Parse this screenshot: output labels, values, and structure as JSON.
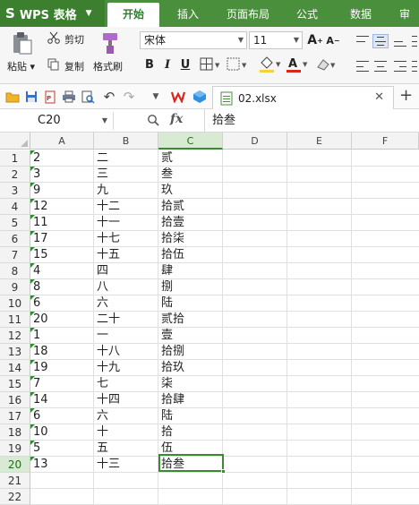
{
  "app": {
    "name": "WPS 表格",
    "logo": "S"
  },
  "tabs": [
    {
      "label": "开始",
      "active": true
    },
    {
      "label": "插入",
      "active": false
    },
    {
      "label": "页面布局",
      "active": false
    },
    {
      "label": "公式",
      "active": false
    },
    {
      "label": "数据",
      "active": false
    },
    {
      "label": "审",
      "active": false
    }
  ],
  "ribbon": {
    "paste": "粘贴",
    "cut": "剪切",
    "copy": "复制",
    "format_painter": "格式刷",
    "font_name": "宋体",
    "font_size": "11",
    "bold": "B",
    "italic": "I",
    "underline": "U",
    "grow_font": "A",
    "shrink_font": "A",
    "font_color_glyph": "A"
  },
  "colors": {
    "brand": "#4a8f3c",
    "accent": "#3b8a33",
    "font_color": "#d9261c",
    "fill_color": "#f4d03f"
  },
  "document": {
    "filename": "02.xlsx"
  },
  "formula_bar": {
    "cell_ref": "C20",
    "fx": "fx",
    "content": "拾叁"
  },
  "columns": [
    "A",
    "B",
    "C",
    "D",
    "E",
    "F"
  ],
  "rows": [
    {
      "n": "1",
      "a": "2",
      "b": "二",
      "c": "贰"
    },
    {
      "n": "2",
      "a": "3",
      "b": "三",
      "c": "叁"
    },
    {
      "n": "3",
      "a": "9",
      "b": "九",
      "c": "玖"
    },
    {
      "n": "4",
      "a": "12",
      "b": "十二",
      "c": "拾贰"
    },
    {
      "n": "5",
      "a": "11",
      "b": "十一",
      "c": "拾壹"
    },
    {
      "n": "6",
      "a": "17",
      "b": "十七",
      "c": "拾柒"
    },
    {
      "n": "7",
      "a": "15",
      "b": "十五",
      "c": "拾伍"
    },
    {
      "n": "8",
      "a": "4",
      "b": "四",
      "c": "肆"
    },
    {
      "n": "9",
      "a": "8",
      "b": "八",
      "c": "捌"
    },
    {
      "n": "10",
      "a": "6",
      "b": "六",
      "c": "陆"
    },
    {
      "n": "11",
      "a": "20",
      "b": "二十",
      "c": "贰拾"
    },
    {
      "n": "12",
      "a": "1",
      "b": "一",
      "c": "壹"
    },
    {
      "n": "13",
      "a": "18",
      "b": "十八",
      "c": "拾捌"
    },
    {
      "n": "14",
      "a": "19",
      "b": "十九",
      "c": "拾玖"
    },
    {
      "n": "15",
      "a": "7",
      "b": "七",
      "c": "柒"
    },
    {
      "n": "16",
      "a": "14",
      "b": "十四",
      "c": "拾肆"
    },
    {
      "n": "17",
      "a": "6",
      "b": "六",
      "c": "陆"
    },
    {
      "n": "18",
      "a": "10",
      "b": "十",
      "c": "拾"
    },
    {
      "n": "19",
      "a": "5",
      "b": "五",
      "c": "伍"
    },
    {
      "n": "20",
      "a": "13",
      "b": "十三",
      "c": "拾叁"
    },
    {
      "n": "21",
      "a": "",
      "b": "",
      "c": ""
    },
    {
      "n": "22",
      "a": "",
      "b": "",
      "c": ""
    }
  ]
}
